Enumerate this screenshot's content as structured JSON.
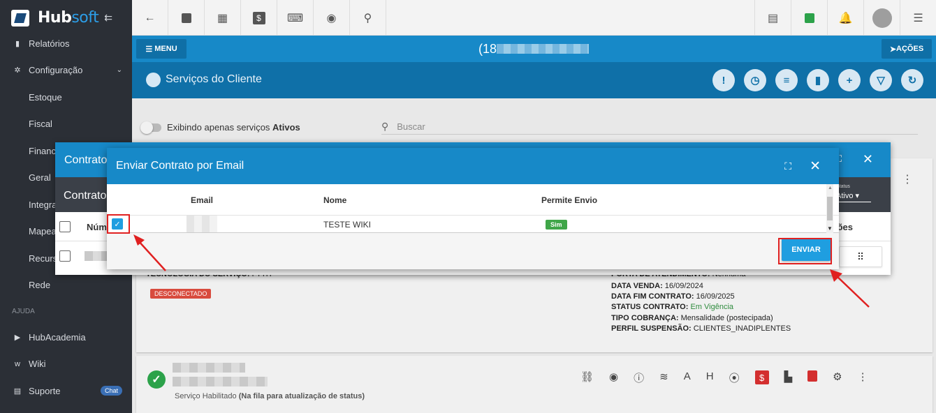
{
  "app": {
    "name_left": "Hub",
    "name_right": "soft"
  },
  "sidebar": {
    "items": [
      {
        "label": "Relatórios",
        "icon": "file-icon"
      },
      {
        "label": "Configuração",
        "icon": "gear-icon"
      },
      {
        "label": "Estoque"
      },
      {
        "label": "Fiscal"
      },
      {
        "label": "Finance"
      },
      {
        "label": "Geral"
      },
      {
        "label": "Integra"
      },
      {
        "label": "Mapea"
      },
      {
        "label": "Recurs"
      },
      {
        "label": "Rede"
      }
    ],
    "section_help": "AJUDA",
    "help_items": [
      {
        "label": "HubAcademia",
        "icon": "youtube-icon"
      },
      {
        "label": "Wiki",
        "icon": "wiki-icon"
      },
      {
        "label": "Suporte",
        "icon": "chat-icon",
        "badge": "Chat"
      }
    ]
  },
  "header": {
    "menu_label": "MENU",
    "phone_prefix": "(18",
    "acoes_label": "AÇÕES",
    "section_title": "Serviços do Cliente"
  },
  "filters": {
    "toggle_text": "Exibindo apenas serviços ",
    "toggle_bold": "Ativos",
    "search_placeholder": "Buscar"
  },
  "service_card": {
    "tech_label": "TECNOLOGIA DO SERVIÇO:",
    "tech_value": "FTTH",
    "status_badge": "DESCONECTADO",
    "porta_label": "PORTA DE ATENDIMENTO:",
    "porta_value": "Nenhuma",
    "data_venda_label": "DATA VENDA:",
    "data_venda_value": "16/09/2024",
    "data_fim_label": "DATA FIM CONTRATO:",
    "data_fim_value": "16/09/2025",
    "status_contrato_label": "STATUS CONTRATO:",
    "status_contrato_value": "Em Vigência",
    "tipo_cobranca_label": "TIPO COBRANÇA:",
    "tipo_cobranca_value": "Mensalidade (postecipada)",
    "perfil_label": "PERFIL SUSPENSÃO:",
    "perfil_value": "CLIENTES_INADIPLENTES"
  },
  "service_card2": {
    "status_text": "Serviço Habilitado",
    "status_note": "(Na fila para atualização de status)"
  },
  "back_modal": {
    "title": "Contrato",
    "subtitle": "Contrato",
    "status_label": "Status",
    "status_value": "Ativo",
    "col_num": "Núm",
    "col_acoes": "ões"
  },
  "modal": {
    "title": "Enviar Contrato por Email",
    "columns": {
      "email": "Email",
      "nome": "Nome",
      "permite": "Permite Envio"
    },
    "rows": [
      {
        "nome": "TESTE WIKI",
        "permite": "Sim",
        "checked": true
      }
    ],
    "send_label": "ENVIAR"
  },
  "colors": {
    "primary": "#1789c8",
    "dark": "#0f70a8",
    "sidebar": "#2b2f36",
    "highlight": "#e02020"
  }
}
